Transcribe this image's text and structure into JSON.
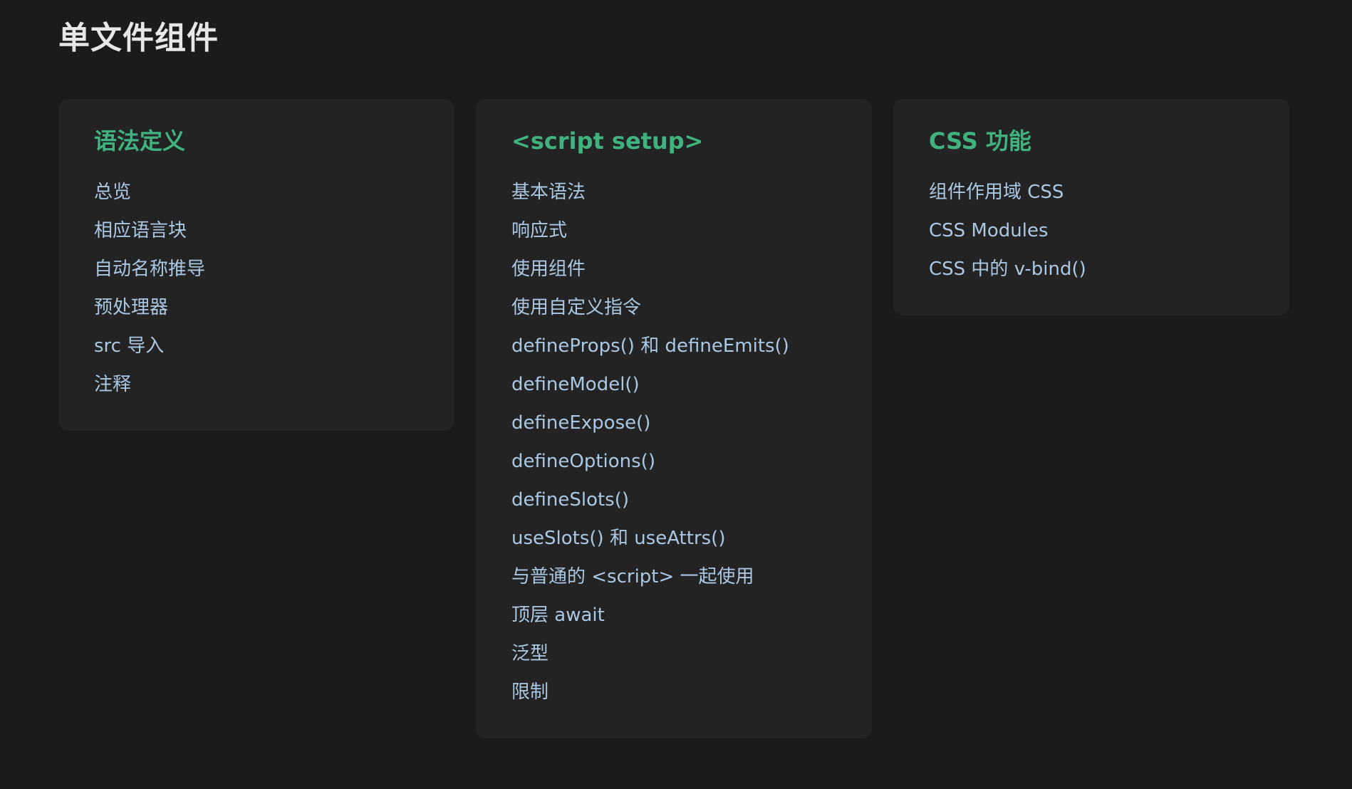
{
  "page": {
    "title": "单文件组件"
  },
  "sections": [
    {
      "title": "语法定义",
      "links": [
        "总览",
        "相应语言块",
        "自动名称推导",
        "预处理器",
        "src 导入",
        "注释"
      ]
    },
    {
      "title": "<script setup>",
      "links": [
        "基本语法",
        "响应式",
        "使用组件",
        "使用自定义指令",
        "defineProps() 和 defineEmits()",
        "defineModel()",
        "defineExpose()",
        "defineOptions()",
        "defineSlots()",
        "useSlots() 和 useAttrs()",
        "与普通的 <script> 一起使用",
        "顶层 await",
        "泛型",
        "限制"
      ]
    },
    {
      "title": "CSS 功能",
      "links": [
        "组件作用域 CSS",
        "CSS Modules",
        "CSS 中的 v-bind()"
      ]
    }
  ],
  "colors": {
    "background": "#1b1b1b",
    "card": "#232323",
    "accent": "#3fb27f",
    "link": "#aac8e4"
  }
}
